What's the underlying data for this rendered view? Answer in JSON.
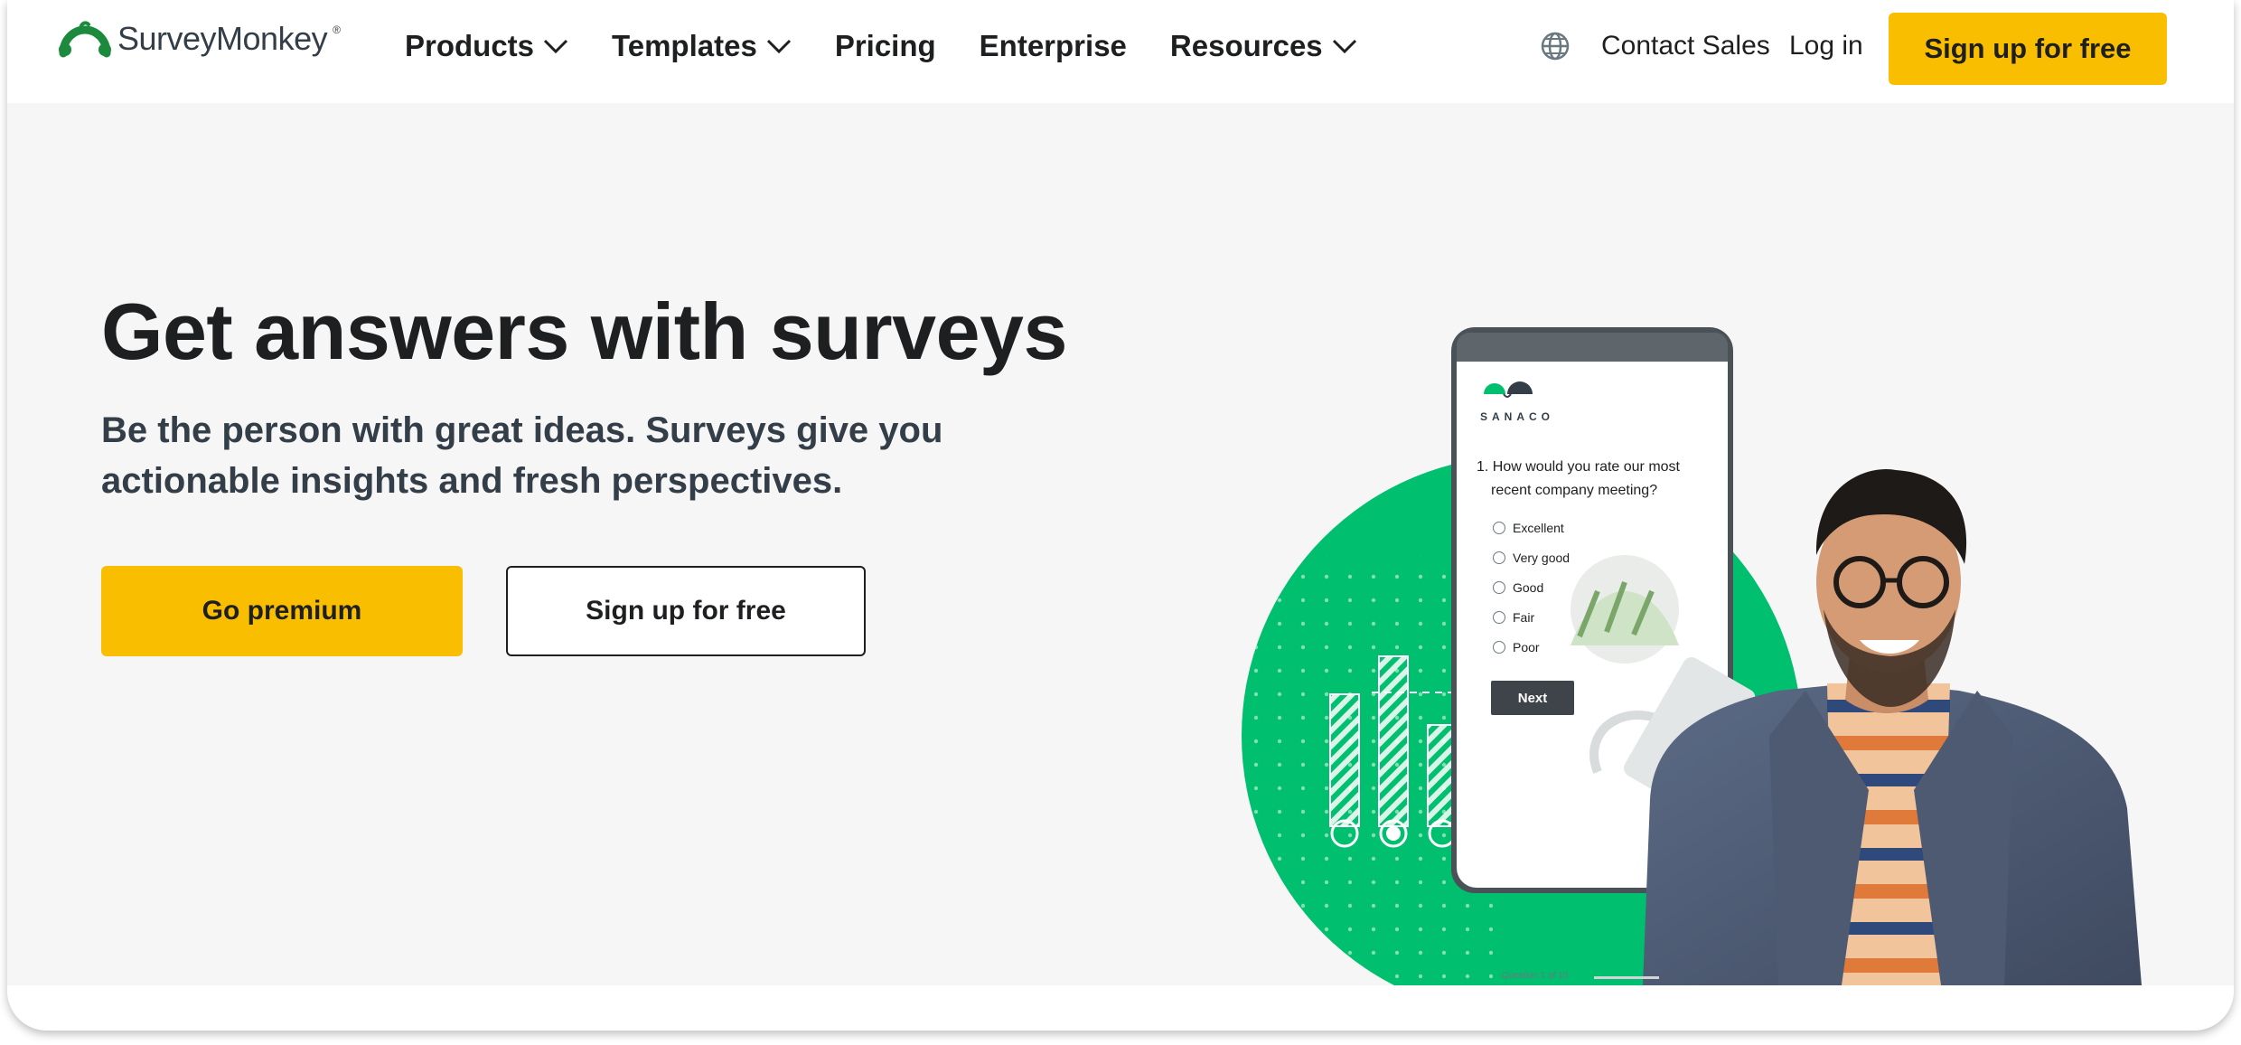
{
  "header": {
    "logo_text": "SurveyMonkey",
    "logo_mark": "®",
    "nav": [
      {
        "label": "Products",
        "has_dropdown": true
      },
      {
        "label": "Templates",
        "has_dropdown": true
      },
      {
        "label": "Pricing",
        "has_dropdown": false
      },
      {
        "label": "Enterprise",
        "has_dropdown": false
      },
      {
        "label": "Resources",
        "has_dropdown": true
      }
    ],
    "contact_label": "Contact Sales",
    "login_label": "Log in",
    "signup_label": "Sign up for free"
  },
  "hero": {
    "headline": "Get answers with surveys",
    "subheadline": "Be the person with great ideas. Surveys give you actionable insights and fresh perspectives.",
    "primary_cta": "Go premium",
    "secondary_cta": "Sign up for free"
  },
  "phone": {
    "brand": "SANACO",
    "question_line1": "1. How would you rate our most",
    "question_line2": "recent company meeting?",
    "options": [
      "Excellent",
      "Very good",
      "Good",
      "Fair",
      "Poor"
    ],
    "next_label": "Next",
    "progress_label": "Question 1 of 10"
  },
  "colors": {
    "brand_green": "#00bf6f",
    "accent_yellow": "#f9be00",
    "text_dark": "#1e1f21",
    "hero_bg": "#f6f6f6"
  },
  "icons": [
    "chevron-down-icon",
    "globe-icon",
    "logo-icon",
    "radio-icon"
  ]
}
